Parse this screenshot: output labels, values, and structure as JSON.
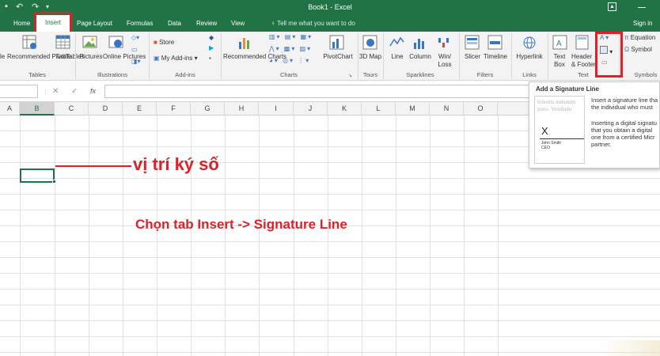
{
  "window": {
    "title": "Book1 - Excel"
  },
  "tabs": [
    "Home",
    "Insert",
    "Page Layout",
    "Formulas",
    "Data",
    "Review",
    "View"
  ],
  "tell_me": "Tell me what you want to do",
  "sign_in": "Sign in",
  "ribbon": {
    "tables": {
      "items": [
        "Recommended PivotTables",
        "Table"
      ],
      "label": "Tables",
      "cut_left": "le"
    },
    "illustrations": {
      "items": [
        "Pictures",
        "Online Pictures"
      ],
      "label": "Illustrations"
    },
    "addins": {
      "items": [
        "Store",
        "My Add-ins"
      ],
      "label": "Add-ins"
    },
    "charts": {
      "items": [
        "Recommended Charts",
        "PivotChart"
      ],
      "label": "Charts"
    },
    "tours": {
      "items": [
        "3D Map"
      ],
      "label": "Tours"
    },
    "sparklines": {
      "items": [
        "Line",
        "Column",
        "Win/ Loss"
      ],
      "label": "Sparklines"
    },
    "filters": {
      "items": [
        "Slicer",
        "Timeline"
      ],
      "label": "Filters"
    },
    "links": {
      "items": [
        "Hyperlink"
      ],
      "label": "Links"
    },
    "text": {
      "items": [
        "Text Box",
        "Header & Footer"
      ],
      "label": "Text"
    },
    "symbols": {
      "items": [
        "Equation",
        "Symbol"
      ],
      "label": "Symbols"
    }
  },
  "formula_bar": {
    "fx": "fx",
    "cancel": "✕",
    "enter": "✓",
    "value": ""
  },
  "columns": [
    "A",
    "B",
    "C",
    "D",
    "E",
    "F",
    "G",
    "H",
    "I",
    "J",
    "K",
    "L",
    "M",
    "N",
    "O"
  ],
  "selected_cell": "B5",
  "annotations": {
    "signature_position": "vị trí ký số",
    "instruction": "Chọn tab Insert -> Signature Line"
  },
  "tooltip": {
    "title": "Add a Signature Line",
    "preview_lorem": [
      "lobortis nonumm",
      "justo. Vestibulu"
    ],
    "preview_x": "X",
    "preview_name": "John Smith",
    "preview_role": "CEO",
    "para1": [
      "Insert a signature line tha",
      "the individual who must"
    ],
    "para2": [
      "Inserting a digital signatu",
      "that you obtain a digital",
      "one from a certified Micr",
      "partner."
    ]
  },
  "colors": {
    "excel_green": "#217346",
    "annotation_red": "#e21e26"
  }
}
